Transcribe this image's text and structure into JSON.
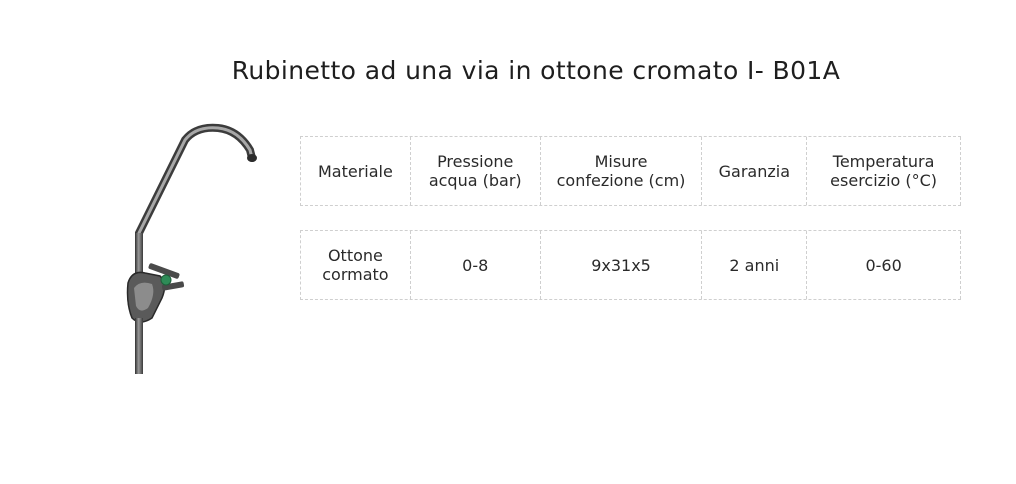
{
  "page": {
    "title": "Rubinetto ad una via in ottone cromato I- B01A"
  },
  "specs": {
    "headers": [
      "Materiale",
      "Pressione\nacqua (bar)",
      "Misure\nconfezione (cm)",
      "Garanzia",
      "Temperatura\nesercizio (°C)"
    ],
    "values": [
      "Ottone\ncormato",
      "0-8",
      "9x31x5",
      "2 anni",
      "0-60"
    ]
  },
  "product_image": {
    "icon": "faucet-icon",
    "colors": {
      "chrome": "#6e6e6e",
      "chrome_dark": "#3a3a3a",
      "handle_accent": "#2e8b57"
    }
  }
}
